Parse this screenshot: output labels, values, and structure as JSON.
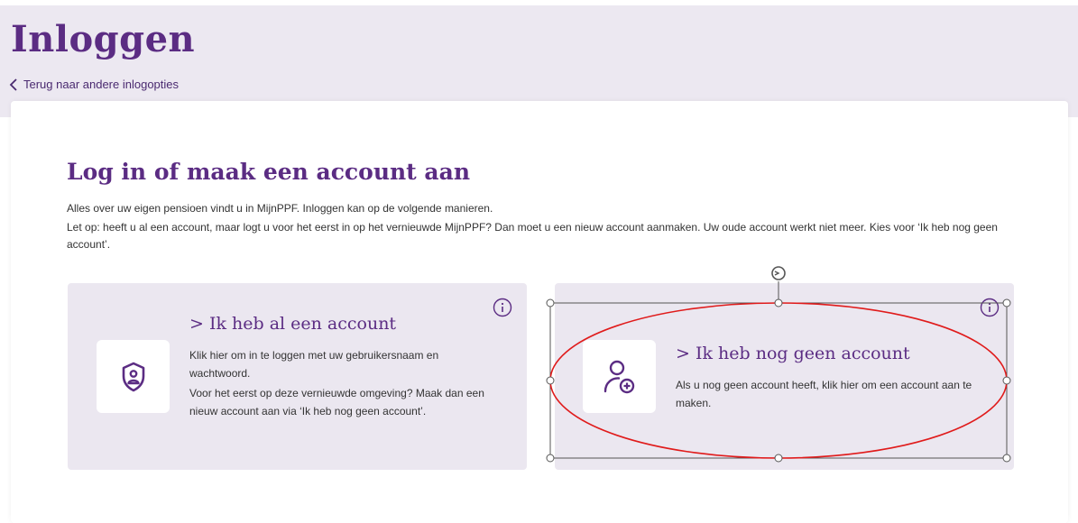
{
  "header": {
    "title": "Inloggen",
    "back_link": "Terug naar andere inlogopties"
  },
  "main": {
    "title": "Log in of maak een account aan",
    "intro": [
      "Alles over uw eigen pensioen vindt u in MijnPPF. Inloggen kan op de volgende manieren.",
      "Let op: heeft u al een account, maar logt u voor het eerst in op het vernieuwde MijnPPF? Dan moet u een nieuw account aanmaken. Uw oude account werkt niet meer. Kies voor ‘Ik heb nog geen account’."
    ],
    "options": [
      {
        "title": "> Ik heb al een account",
        "text": [
          "Klik hier om in te loggen met uw gebruikersnaam en wachtwoord.",
          "Voor het eerst op deze vernieuwde omgeving? Maak dan een nieuw account aan via ‘Ik heb nog geen account’."
        ],
        "icon": "shield-user-icon",
        "info_icon": "info-icon"
      },
      {
        "title": "> Ik heb nog geen account",
        "text": [
          "Als u nog geen account heeft, klik hier om een account aan te maken."
        ],
        "icon": "add-user-icon",
        "info_icon": "info-icon"
      }
    ]
  },
  "colors": {
    "brand_purple": "#5b2c83",
    "header_bg": "#ece8f1",
    "card_bg": "#ebe7f0",
    "annotation_red": "#e01b1b"
  }
}
